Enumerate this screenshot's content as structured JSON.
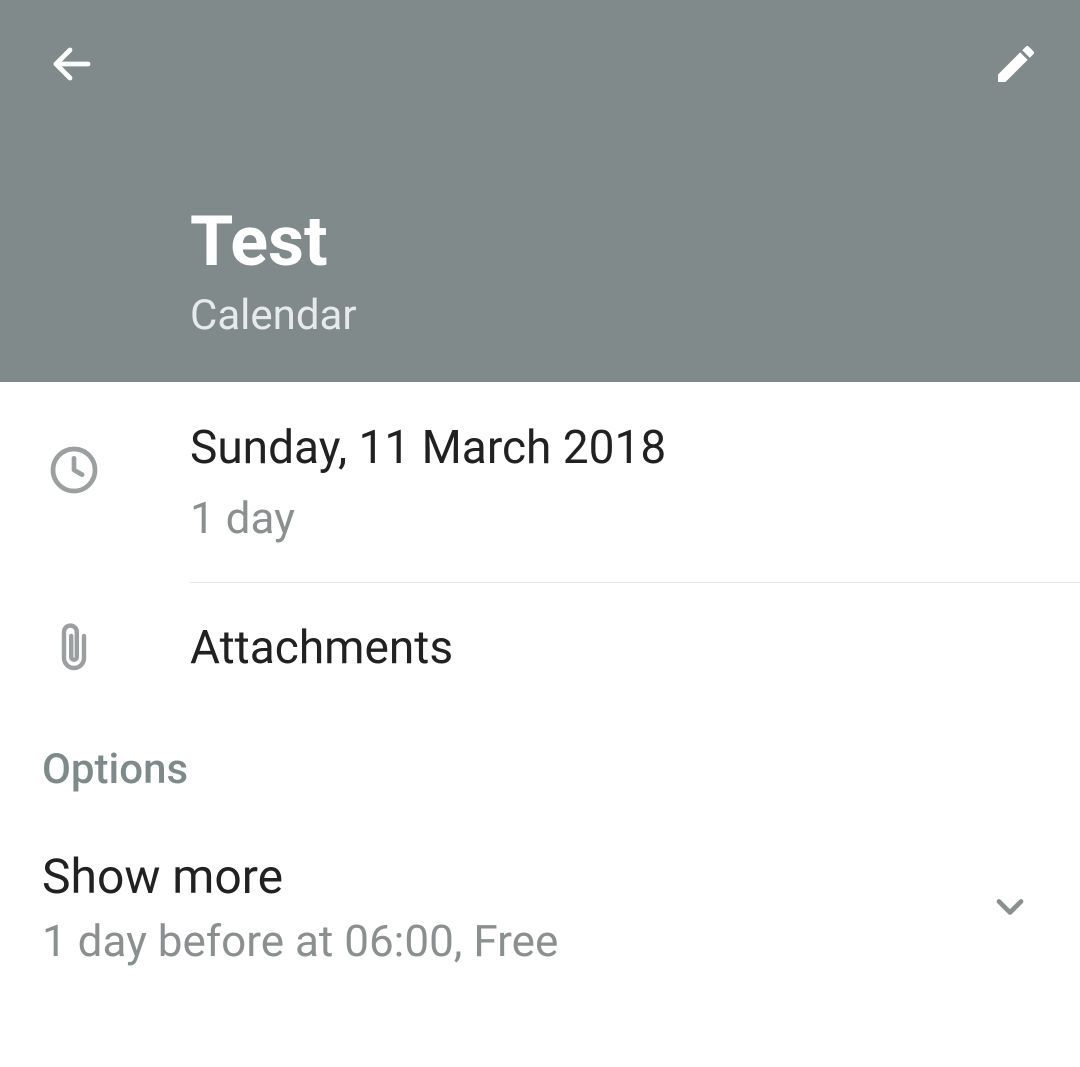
{
  "header": {
    "title": "Test",
    "subtitle": "Calendar"
  },
  "date": {
    "primary": "Sunday, 11 March 2018",
    "secondary": "1 day"
  },
  "attachments": {
    "label": "Attachments"
  },
  "options": {
    "heading": "Options",
    "show_more_label": "Show more",
    "show_more_detail": "1 day before at 06:00, Free"
  }
}
